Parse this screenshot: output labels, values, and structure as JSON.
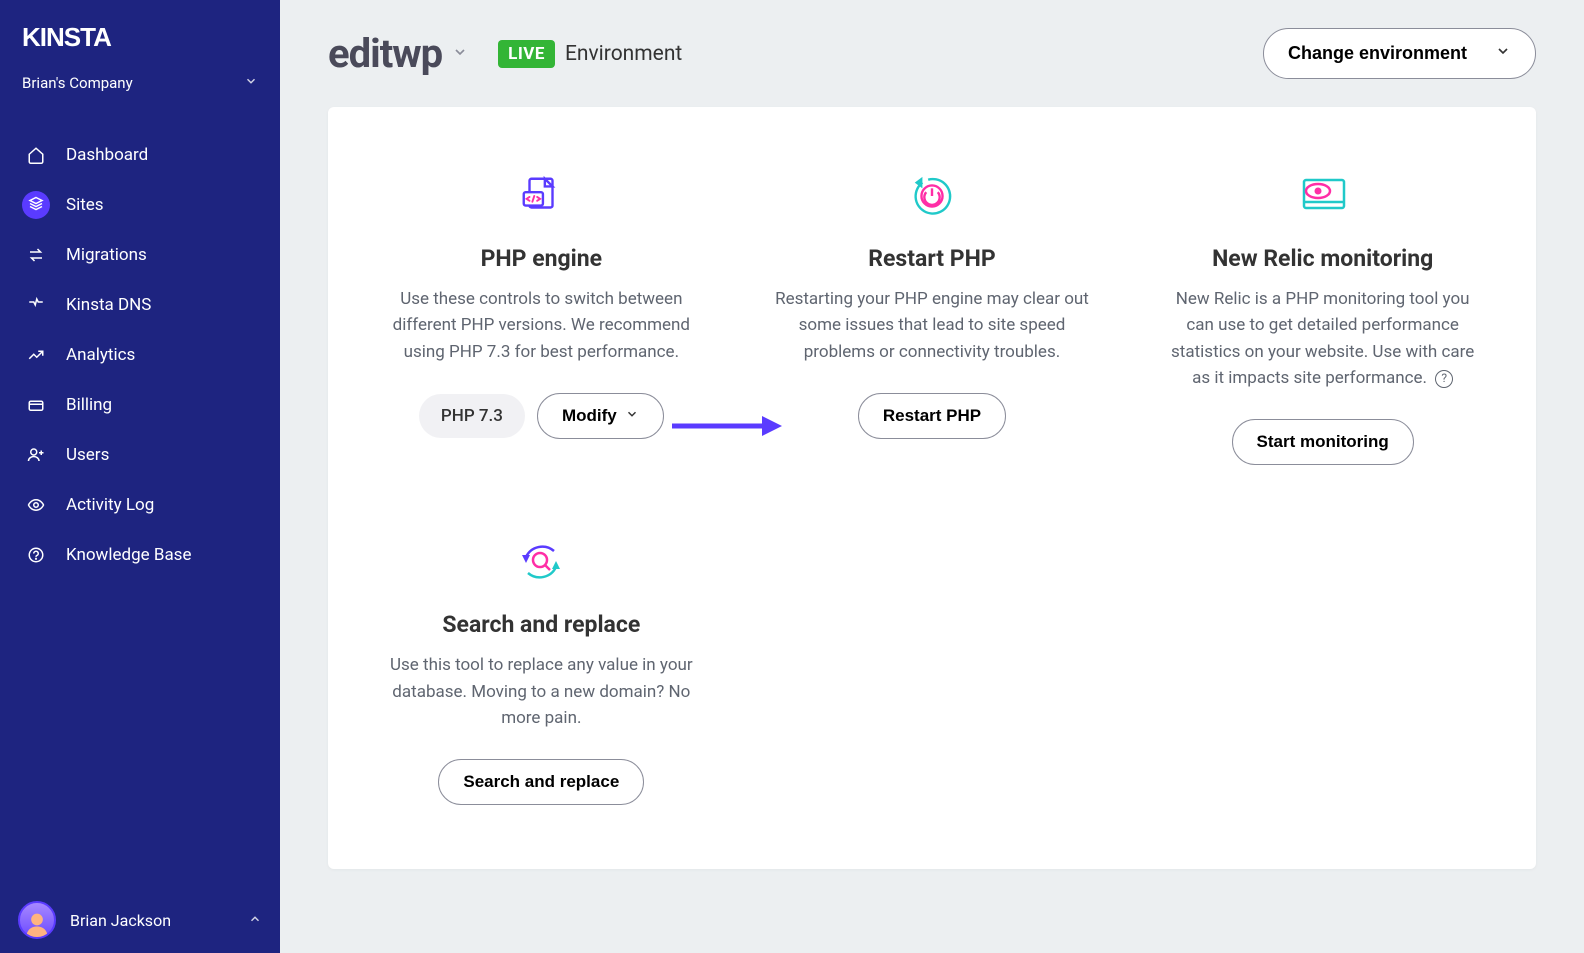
{
  "brand": "KINSTA",
  "company": "Brian's Company",
  "nav": [
    {
      "label": "Dashboard",
      "icon": "home"
    },
    {
      "label": "Sites",
      "icon": "sites",
      "active": true
    },
    {
      "label": "Migrations",
      "icon": "migrations"
    },
    {
      "label": "Kinsta DNS",
      "icon": "dns"
    },
    {
      "label": "Analytics",
      "icon": "analytics"
    },
    {
      "label": "Billing",
      "icon": "billing"
    },
    {
      "label": "Users",
      "icon": "users"
    },
    {
      "label": "Activity Log",
      "icon": "activity"
    },
    {
      "label": "Knowledge Base",
      "icon": "kb"
    }
  ],
  "user": "Brian Jackson",
  "header": {
    "site_name": "editwp",
    "live_badge": "LIVE",
    "env_label": "Environment",
    "change_env": "Change environment"
  },
  "tools": {
    "php_engine": {
      "title": "PHP engine",
      "desc": "Use these controls to switch between different PHP versions. We recommend using PHP 7.3 for best performance.",
      "version_badge": "PHP 7.3",
      "modify_btn": "Modify"
    },
    "restart_php": {
      "title": "Restart PHP",
      "desc": "Restarting your PHP engine may clear out some issues that lead to site speed problems or connectivity troubles.",
      "btn": "Restart PHP"
    },
    "new_relic": {
      "title": "New Relic monitoring",
      "desc": "New Relic is a PHP monitoring tool you can use to get detailed performance statistics on your website. Use with care as it impacts site performance.",
      "btn": "Start monitoring"
    },
    "search_replace": {
      "title": "Search and replace",
      "desc": "Use this tool to replace any value in your database. Moving to a new domain? No more pain.",
      "btn": "Search and replace"
    }
  }
}
